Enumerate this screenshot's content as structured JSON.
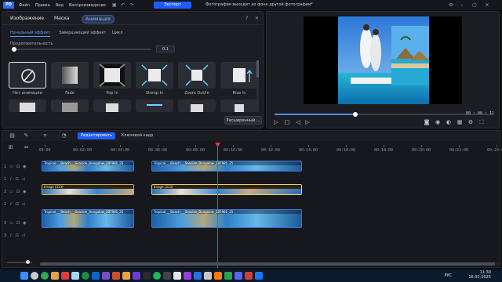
{
  "titlebar": {
    "menu": [
      "Файл",
      "Правка",
      "Вид",
      "Воспроизведение"
    ],
    "export_label": "Экспорт",
    "window_title": "Фотография выходит из фона другой фотографии*"
  },
  "left_panel": {
    "tabs": [
      "Изображение",
      "Маска",
      "Анимация"
    ],
    "sub_tabs": [
      "Начальный эффект",
      "Завершающий эффект",
      "Цикл"
    ],
    "duration_label": "Продолжительность",
    "duration_value": "0.1",
    "animations": [
      {
        "label": "Нет анимации",
        "icon": "no-animation-icon"
      },
      {
        "label": "Fade",
        "icon": "fade-icon"
      },
      {
        "label": "Pop In",
        "icon": "pop-in-icon"
      },
      {
        "label": "Stomp In",
        "icon": "stomp-in-icon"
      },
      {
        "label": "Zoom Out/In",
        "icon": "zoom-out-in-icon"
      },
      {
        "label": "Rise In",
        "icon": "rise-in-icon"
      }
    ],
    "advanced_label": "Расширенный ..."
  },
  "preview": {
    "timecode": "00 : 00 : 11",
    "progress": 0.37
  },
  "timeline": {
    "edit_label": "Редактировать",
    "keyframe_label": "Ключевой кадр",
    "ruler_ticks": [
      "00:00",
      "00:02:00",
      "00:04:00",
      "00:06:00",
      "00:08:00",
      "00:10:00",
      "00:12:00",
      "00:14:00",
      "00:16:00",
      "00:18:00",
      "00:20:00",
      "00:22:00",
      "00:24:00"
    ],
    "clips": {
      "video_title": "Tropical___Beach___Seaside_Bungalow_287981_25",
      "image_title": "Image (313)"
    },
    "track_numbers": [
      "1",
      "1",
      "2",
      "2",
      "3",
      "3"
    ]
  },
  "taskbar": {
    "lang": "РУС",
    "time": "11:30",
    "date": "16.02.2025"
  },
  "colors": {
    "accent": "#1f5cff",
    "playhead": "#e0353b",
    "image_clip": "#d1ad3d"
  }
}
